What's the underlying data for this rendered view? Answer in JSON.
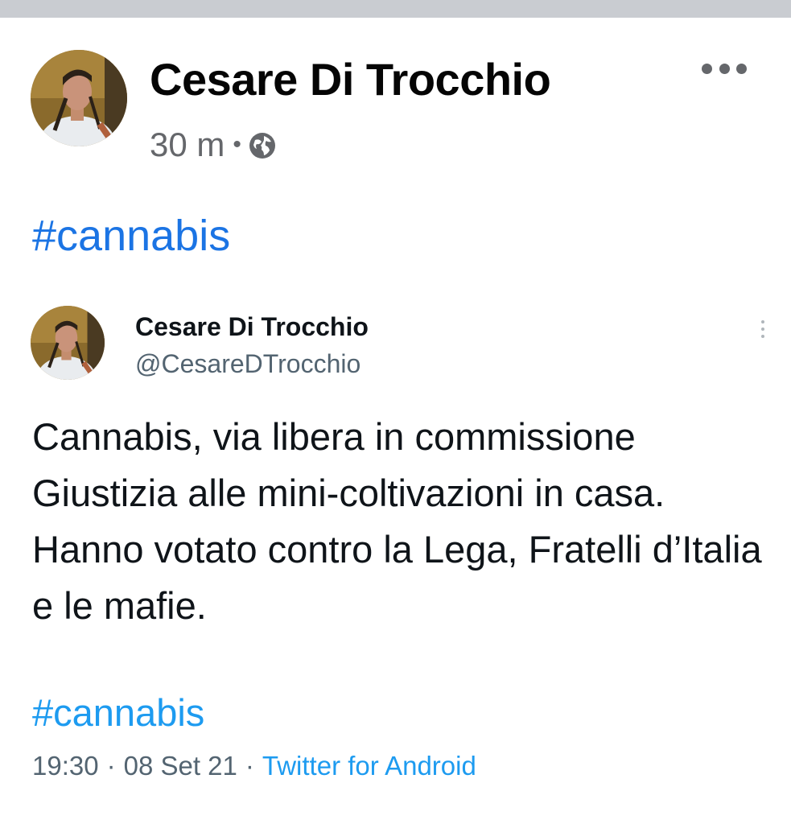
{
  "post": {
    "author_name": "Cesare Di Trocchio",
    "time": "30 m",
    "separator": "•",
    "privacy_icon": "globe-icon",
    "more_icon": "more-horizontal-icon",
    "hashtag": "#cannabis"
  },
  "tweet": {
    "author_name": "Cesare Di Trocchio",
    "handle": "@CesareDTrocchio",
    "more_icon": "more-vertical-icon",
    "text": "Cannabis, via libera in commissione Giustizia alle mini-coltivazioni in casa. Hanno votato contro la Lega, Fratelli d’Italia e le mafie.",
    "hashtag": "#cannabis",
    "time": "19:30",
    "sep1": "·",
    "date": "08 Set 21",
    "sep2": "·",
    "source": "Twitter for Android"
  },
  "colors": {
    "facebook_link": "#1b74e4",
    "twitter_link": "#1d9bf0",
    "meta_gray": "#65676b",
    "top_bar": "#c9ccd1"
  }
}
